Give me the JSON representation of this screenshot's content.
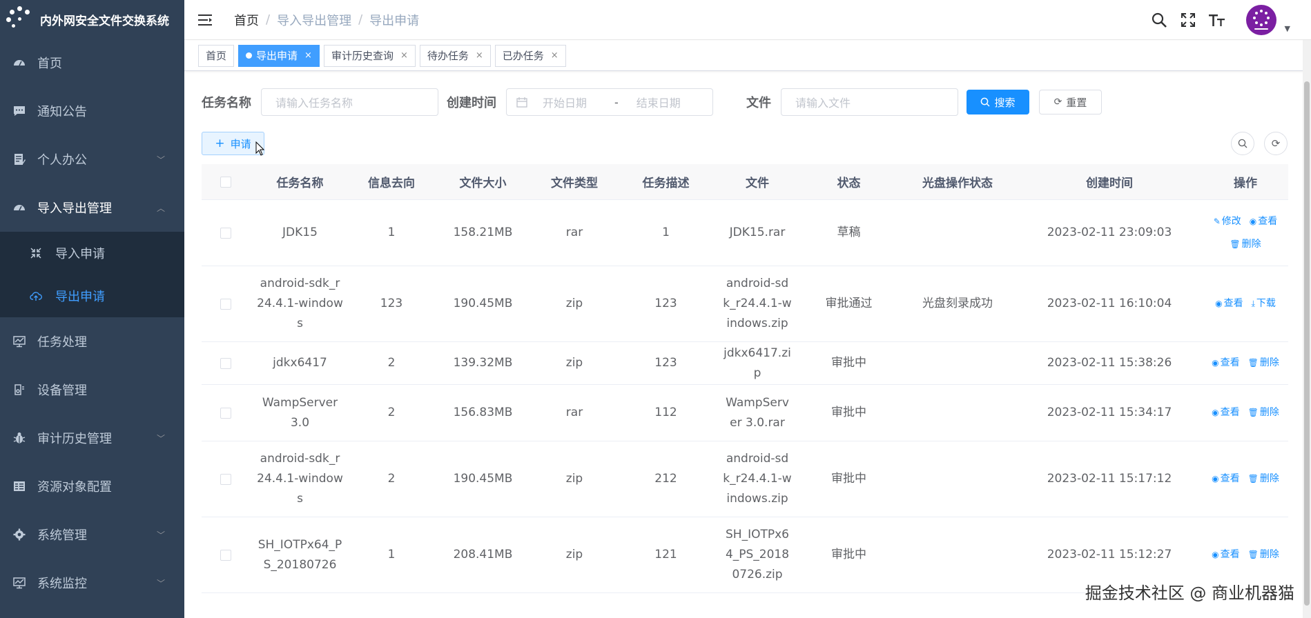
{
  "app": {
    "title": "内外网安全文件交换系统"
  },
  "sidebar": {
    "items": [
      {
        "label": "首页",
        "icon": "dashboard-icon"
      },
      {
        "label": "通知公告",
        "icon": "message-icon"
      },
      {
        "label": "个人办公",
        "icon": "form-icon",
        "expandable": true
      },
      {
        "label": "导入导出管理",
        "icon": "dashboard-icon",
        "expandable": true,
        "open": true
      },
      {
        "label": "任务处理",
        "icon": "monitor-icon"
      },
      {
        "label": "设备管理",
        "icon": "device-icon"
      },
      {
        "label": "审计历史管理",
        "icon": "bug-icon",
        "expandable": true
      },
      {
        "label": "资源对象配置",
        "icon": "list-icon"
      },
      {
        "label": "系统管理",
        "icon": "gear-icon",
        "expandable": true
      },
      {
        "label": "系统监控",
        "icon": "monitor-icon",
        "expandable": true
      }
    ],
    "sub_items": [
      {
        "label": "导入申请",
        "icon": "compress-icon"
      },
      {
        "label": "导出申请",
        "icon": "cloud-upload-icon",
        "active": true
      }
    ]
  },
  "header": {
    "breadcrumb": [
      "首页",
      "导入导出管理",
      "导出申请"
    ]
  },
  "tags": [
    {
      "label": "首页"
    },
    {
      "label": "导出申请",
      "active": true
    },
    {
      "label": "审计历史查询"
    },
    {
      "label": "待办任务"
    },
    {
      "label": "已办任务"
    }
  ],
  "search": {
    "task_name_label": "任务名称",
    "task_name_placeholder": "请输入任务名称",
    "created_label": "创建时间",
    "start_placeholder": "开始日期",
    "range_sep": "-",
    "end_placeholder": "结束日期",
    "file_label": "文件",
    "file_placeholder": "请输入文件",
    "search_btn": "搜索",
    "reset_btn": "重置"
  },
  "toolbar": {
    "apply_btn": "申请"
  },
  "table": {
    "columns": [
      "任务名称",
      "信息去向",
      "文件大小",
      "文件类型",
      "任务描述",
      "文件",
      "状态",
      "光盘操作状态",
      "创建时间",
      "操作"
    ],
    "rows": [
      {
        "name": "JDK15",
        "dest": "1",
        "size": "158.21MB",
        "type": "rar",
        "desc": "1",
        "file": "JDK15.rar",
        "status": "草稿",
        "disc": "",
        "time": "2023-02-11 23:09:03",
        "ops": [
          "修改",
          "查看",
          "删除"
        ]
      },
      {
        "name": "android-sdk_r24.4.1-windows",
        "dest": "123",
        "size": "190.45MB",
        "type": "zip",
        "desc": "123",
        "file": "android-sdk_r24.4.1-windows.zip",
        "status": "审批通过",
        "disc": "光盘刻录成功",
        "time": "2023-02-11 16:10:04",
        "ops": [
          "查看",
          "下载"
        ]
      },
      {
        "name": "jdkx6417",
        "dest": "2",
        "size": "139.32MB",
        "type": "zip",
        "desc": "123",
        "file": "jdkx6417.zip",
        "status": "审批中",
        "disc": "",
        "time": "2023-02-11 15:38:26",
        "ops": [
          "查看",
          "删除"
        ]
      },
      {
        "name": "WampServer 3.0",
        "dest": "2",
        "size": "156.83MB",
        "type": "rar",
        "desc": "112",
        "file": "WampServer 3.0.rar",
        "status": "审批中",
        "disc": "",
        "time": "2023-02-11 15:34:17",
        "ops": [
          "查看",
          "删除"
        ]
      },
      {
        "name": "android-sdk_r24.4.1-windows",
        "dest": "2",
        "size": "190.45MB",
        "type": "zip",
        "desc": "212",
        "file": "android-sdk_r24.4.1-windows.zip",
        "status": "审批中",
        "disc": "",
        "time": "2023-02-11 15:17:12",
        "ops": [
          "查看",
          "删除"
        ]
      },
      {
        "name": "SH_IOTPx64_PS_20180726",
        "dest": "1",
        "size": "208.41MB",
        "type": "zip",
        "desc": "121",
        "file": "SH_IOTPx64_PS_20180726.zip",
        "status": "审批中",
        "disc": "",
        "time": "2023-02-11 15:12:27",
        "ops": [
          "查看",
          "删除"
        ]
      }
    ]
  },
  "watermark": "掘金技术社区 @ 商业机器猫",
  "colors": {
    "sidebar_bg": "#304156",
    "submenu_bg": "#1f2d3d",
    "primary": "#1890ff",
    "active_text": "#409eff"
  }
}
